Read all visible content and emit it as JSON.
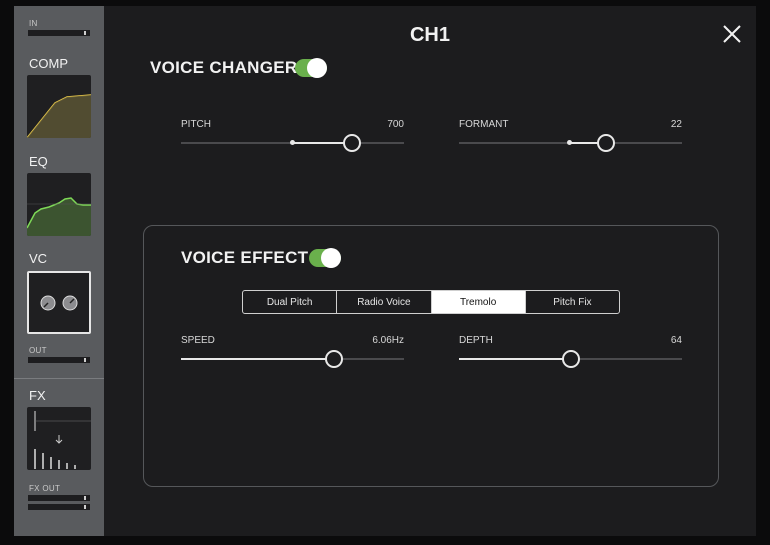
{
  "window": {
    "title": "CH1"
  },
  "sidebar": {
    "in_label": "IN",
    "comp_label": "COMP",
    "eq_label": "EQ",
    "vc_label": "VC",
    "out_label": "OUT",
    "fx_label": "FX",
    "fx_out_label": "FX OUT"
  },
  "voice_changer": {
    "title": "VOICE CHANGER",
    "enabled": true,
    "pitch": {
      "label": "PITCH",
      "value": "700"
    },
    "formant": {
      "label": "FORMANT",
      "value": "22"
    }
  },
  "voice_effect": {
    "title": "VOICE EFFECT",
    "enabled": true,
    "modes": [
      "Dual Pitch",
      "Radio Voice",
      "Tremolo",
      "Pitch Fix"
    ],
    "selected_mode": "Tremolo",
    "speed": {
      "label": "SPEED",
      "value": "6.06Hz"
    },
    "depth": {
      "label": "DEPTH",
      "value": "64"
    }
  },
  "colors": {
    "accent_green": "#6ab04c",
    "panel": "#1c1c1e",
    "sidebar": "#595b5e",
    "comp_curve": "#e8c84a",
    "eq_curve": "#7ed957"
  },
  "icons": {
    "close": "close-icon",
    "pointer": "selection-pointer-icon"
  }
}
